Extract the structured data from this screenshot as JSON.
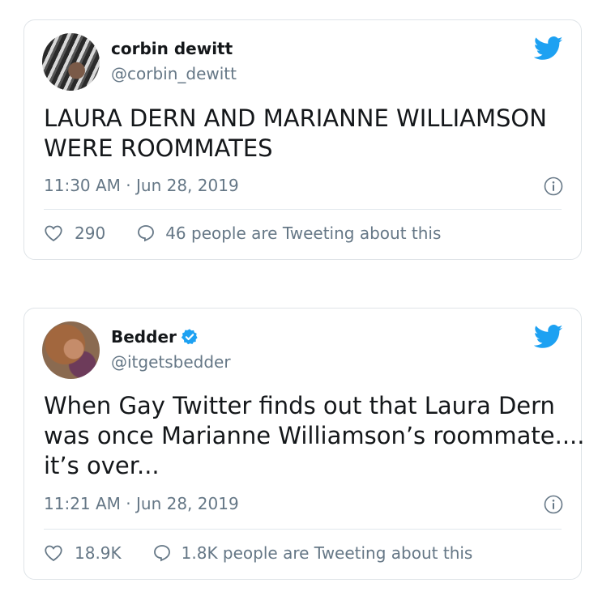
{
  "tweets": [
    {
      "name": "corbin dewitt",
      "handle": "@corbin_dewitt",
      "verified": false,
      "text_lines": [
        "LAURA DERN AND MARIANNE WILLIAMSON",
        "WERE ROOMMATES"
      ],
      "timestamp": "11:30 AM · Jun 28, 2019",
      "likes": "290",
      "conversation": "46 people are Tweeting about this"
    },
    {
      "name": "Bedder",
      "handle": "@itgetsbedder",
      "verified": true,
      "text_lines": [
        "When Gay Twitter finds out that Laura Dern",
        "was once Marianne Williamson’s roommate....",
        "it’s over..."
      ],
      "timestamp": "11:21 AM · Jun 28, 2019",
      "likes": "18.9K",
      "conversation": "1.8K people are Tweeting about this"
    }
  ],
  "colors": {
    "twitter_blue": "#1da1f2",
    "secondary_text": "#657786",
    "primary_text": "#14171a",
    "border": "#dfe4e8"
  },
  "icons": {
    "brand": "twitter-bird-icon",
    "verified": "verified-badge-icon",
    "info": "info-icon",
    "like": "heart-icon",
    "reply": "speech-bubble-icon"
  }
}
